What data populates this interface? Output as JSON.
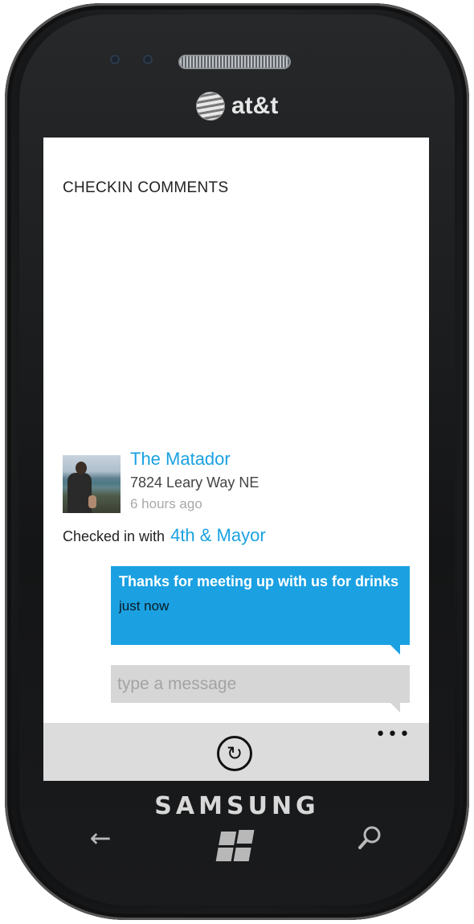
{
  "device": {
    "carrier": "at&t",
    "brand": "SAMSUNG",
    "back_icon": "back-arrow-icon",
    "start_icon": "windows-logo-icon",
    "search_icon": "search-icon"
  },
  "page": {
    "title": "CHECKIN COMMENTS"
  },
  "checkin": {
    "place_name": "The Matador",
    "address": "7824 Leary Way NE",
    "time": "6 hours ago",
    "with_prefix": "Checked in with",
    "with_link": "4th & Mayor"
  },
  "messages": [
    {
      "text": "Thanks for meeting up with us for drinks",
      "time": "just now"
    }
  ],
  "composer": {
    "placeholder": "type a message"
  },
  "appbar": {
    "more_label": "•••",
    "refresh_icon": "refresh-icon"
  },
  "colors": {
    "accent": "#1ba1e2",
    "appbar_bg": "#dcdcdc",
    "input_bg": "#d6d6d6"
  }
}
